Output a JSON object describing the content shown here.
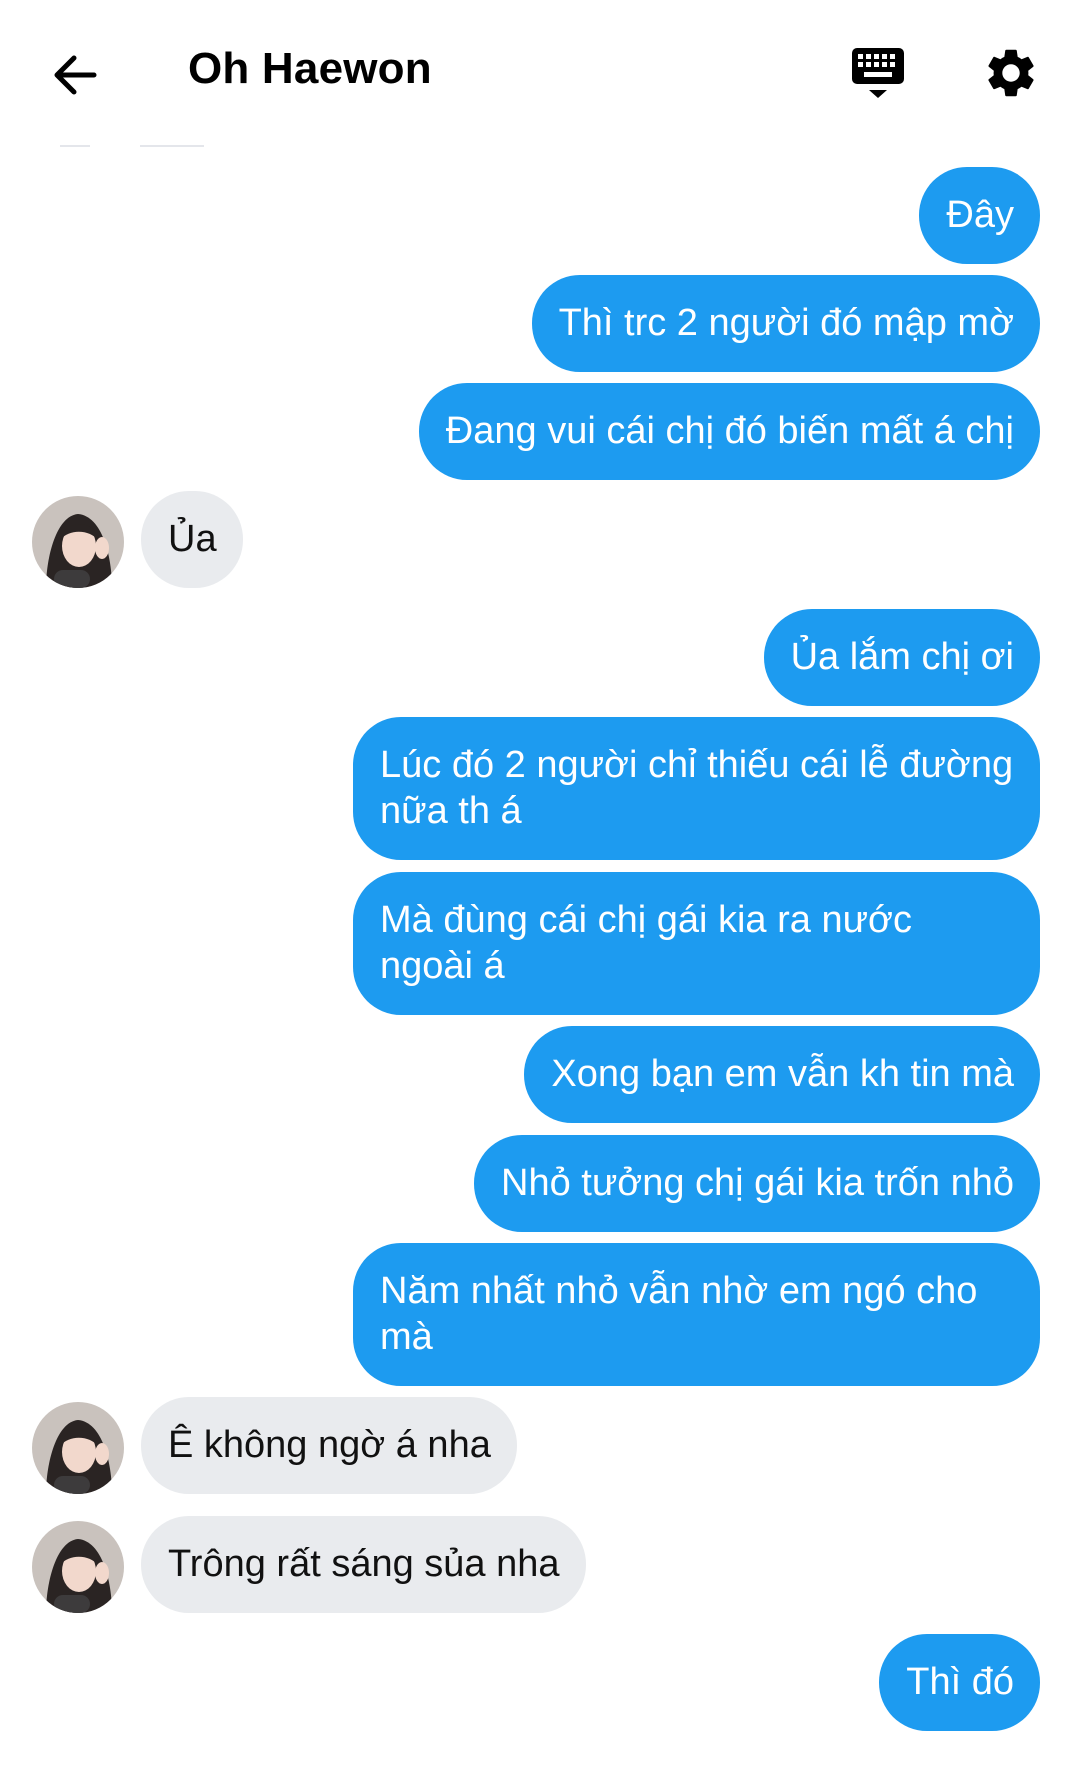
{
  "header": {
    "title": "Oh Haewon"
  },
  "messages": [
    {
      "from": "me",
      "text": "Đây"
    },
    {
      "from": "me",
      "text": "Thì trc 2 người đó mập mờ"
    },
    {
      "from": "me",
      "text": "Đang vui cái chị đó biến mất á chị"
    },
    {
      "from": "them",
      "text": "Ủa"
    },
    {
      "from": "me",
      "text": "Ủa lắm chị ơi"
    },
    {
      "from": "me",
      "text": "Lúc đó 2 người chỉ thiếu cái lễ đường nữa th á"
    },
    {
      "from": "me",
      "text": "Mà đùng cái chị gái kia ra nước ngoài á"
    },
    {
      "from": "me",
      "text": "Xong bạn em vẫn kh tin mà"
    },
    {
      "from": "me",
      "text": "Nhỏ tưởng chị gái kia trốn nhỏ"
    },
    {
      "from": "me",
      "text": "Năm nhất nhỏ vẫn nhờ em ngó cho mà"
    },
    {
      "from": "them",
      "text": "Ê không ngờ á nha"
    },
    {
      "from": "them",
      "text": "Trông rất sáng sủa nha"
    },
    {
      "from": "me",
      "text": "Thì đó"
    }
  ],
  "colors": {
    "sent_bubble": "#1d9bf0",
    "received_bubble": "#e9ebee",
    "sent_text": "#ffffff",
    "received_text": "#111111"
  },
  "icons": {
    "back": "arrow-left-icon",
    "keyboard": "keyboard-icon",
    "settings": "gear-icon"
  }
}
